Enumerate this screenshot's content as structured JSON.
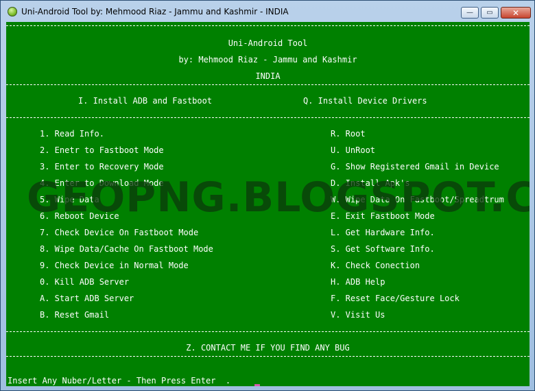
{
  "window": {
    "title": "Uni-Android Tool by: Mehmood Riaz - Jammu and Kashmir - INDIA",
    "minimize_glyph": "—",
    "maximize_glyph": "▭",
    "close_glyph": "✕"
  },
  "header": {
    "app_name": "Uni-Android Tool",
    "by_line": "by: Mehmood Riaz - Jammu and Kashmir",
    "country": "INDIA"
  },
  "install": {
    "left": "I. Install ADB and Fastboot",
    "right": "Q. Install Device Drivers"
  },
  "menu_left": [
    "1. Read Info.",
    "2. Enetr to Fastboot Mode",
    "3. Enter to Recovery Mode",
    "4. Enter to Download Mode",
    "5. Wipe Data",
    "6. Reboot Device",
    "7. Check Device On Fastboot Mode",
    "8. Wipe Data/Cache On Fastboot Mode",
    "9. Check Device in Normal Mode",
    "0. Kill ADB Server",
    "A. Start ADB Server",
    "B. Reset Gmail"
  ],
  "menu_right": [
    "R. Root",
    "U. UnRoot",
    "G. Show Registered Gmail in Device",
    "D. Install Apk's",
    "W. Wipe Data On Fastboot/Spreadtrum",
    "E. Exit Fastboot Mode",
    "L. Get Hardware Info.",
    "S. Get Software Info.",
    "K. Check Conection",
    "H. ADB Help",
    "F. Reset Face/Gesture Lock",
    "V. Visit Us"
  ],
  "contact": "Z. CONTACT ME IF YOU FIND ANY BUG",
  "prompt": "Insert Any Nuber/Letter - Then Press Enter  .",
  "watermark": "GEOPNG.BLOGSPOT.COM",
  "colors": {
    "console_bg": "#008000",
    "console_text": "#ffffff",
    "cursor": "#d85ab0"
  }
}
